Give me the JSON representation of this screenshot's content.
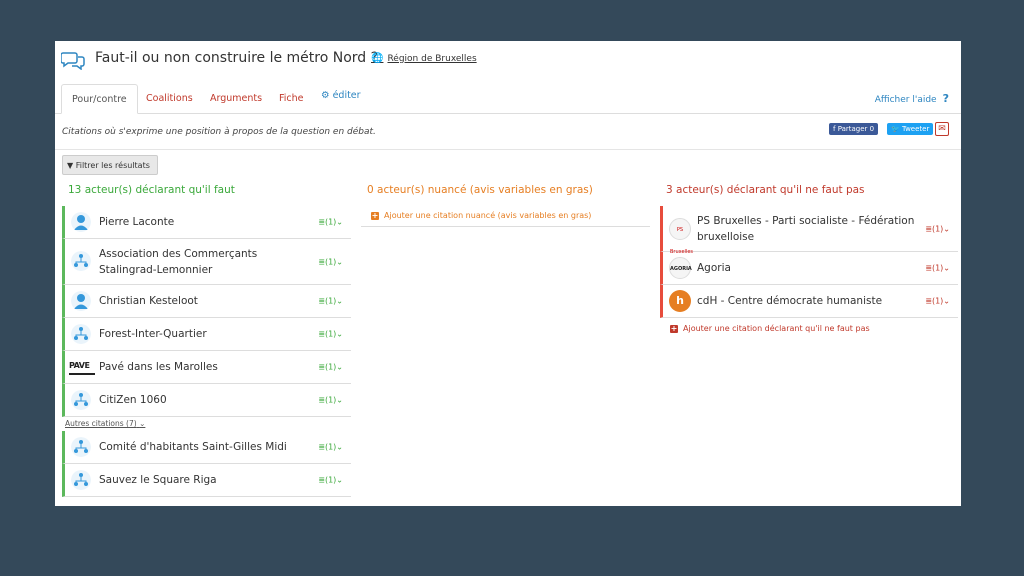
{
  "header": {
    "title": "Faut-il ou non construire le métro Nord ?",
    "region": "Région de Bruxelles"
  },
  "tabs": [
    {
      "label": "Pour/contre"
    },
    {
      "label": "Coalitions"
    },
    {
      "label": "Arguments"
    },
    {
      "label": "Fiche"
    },
    {
      "label": "éditer"
    }
  ],
  "help": {
    "label": "Afficher l'aide",
    "q": "?"
  },
  "subline": "Citations où s'exprime une position à propos de la question en débat.",
  "share": {
    "facebook": "Partager 0",
    "twitter": "Tweeter",
    "mail_icon": "envelope-icon"
  },
  "filter_label": "Filtrer les résultats",
  "columns": {
    "for": {
      "heading": "13 acteur(s) déclarant qu'il faut",
      "items": [
        {
          "name": "Pierre Laconte",
          "count": "(1)"
        },
        {
          "name": "Association des Commerçants Stalingrad-Lemonnier",
          "count": "(1)"
        },
        {
          "name": "Christian Kesteloot",
          "count": "(1)"
        },
        {
          "name": "Forest-Inter-Quartier",
          "count": "(1)"
        },
        {
          "name": "Pavé dans les Marolles",
          "count": "(1)"
        },
        {
          "name": "CitiZen 1060",
          "count": "(1)"
        }
      ],
      "other": "Autres citations (7)",
      "more_items": [
        {
          "name": "Comité d'habitants Saint-Gilles Midi",
          "count": "(1)"
        },
        {
          "name": "Sauvez le Square Riga",
          "count": "(1)"
        }
      ]
    },
    "nuanced": {
      "heading": "0 acteur(s) nuancé (avis variables en gras)",
      "add": "Ajouter une citation nuancé (avis variables en gras)"
    },
    "against": {
      "heading": "3 acteur(s) déclarant qu'il ne faut pas",
      "items": [
        {
          "name": "PS Bruxelles - Parti socialiste - Fédération bruxelloise",
          "count": "(1)",
          "logo": "PS Bruxelles"
        },
        {
          "name": "Agoria",
          "count": "(1)",
          "logo": "AGORIA"
        },
        {
          "name": "cdH - Centre démocrate humaniste",
          "count": "(1)",
          "logo": "h"
        }
      ],
      "add": "Ajouter une citation déclarant qu'il ne faut pas"
    }
  },
  "logos": {
    "pave": "PAVE"
  },
  "colors": {
    "green": "#3aa83a",
    "orange": "#e67e22",
    "red": "#c0392b",
    "link": "#2e86c1",
    "background": "#34495a"
  }
}
